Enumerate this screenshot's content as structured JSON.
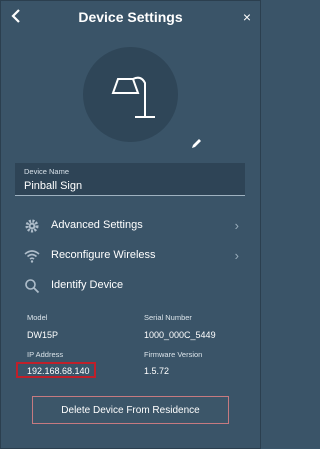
{
  "header": {
    "title": "Device Settings",
    "back_icon": "back-arrow-icon",
    "close_label": "×"
  },
  "device": {
    "icon": "lamp-icon",
    "name_label": "Device Name",
    "name_value": "Pinball Sign"
  },
  "menu": {
    "items": [
      {
        "label": "Advanced Settings",
        "icon": "gear-icon",
        "has_chevron": true
      },
      {
        "label": "Reconfigure Wireless",
        "icon": "wifi-icon",
        "has_chevron": true
      },
      {
        "label": "Identify Device",
        "icon": "search-icon",
        "has_chevron": false
      }
    ]
  },
  "info": {
    "model_label": "Model",
    "model_value": "DW15P",
    "serial_label": "Serial Number",
    "serial_value": "1000_000C_5449",
    "ip_label": "IP Address",
    "ip_value": "192.168.68.140",
    "firmware_label": "Firmware Version",
    "firmware_value": "1.5.72"
  },
  "actions": {
    "delete_label": "Delete Device From Residence"
  },
  "colors": {
    "background": "#3a5468",
    "highlight": "#c0202a"
  }
}
